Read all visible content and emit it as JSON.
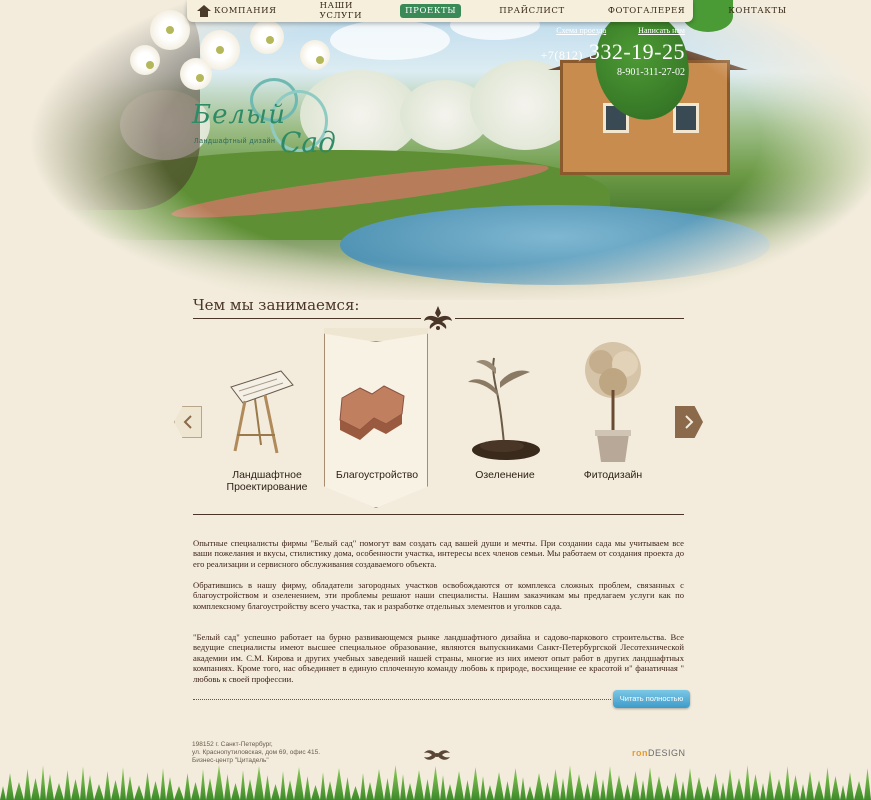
{
  "nav": {
    "home_icon": "home-icon",
    "items": [
      {
        "label": "КОМПАНИЯ",
        "active": false
      },
      {
        "label": "НАШИ УСЛУГИ",
        "active": false
      },
      {
        "label": "ПРОЕКТЫ",
        "active": true
      },
      {
        "label": "ПРАЙСЛИСТ",
        "active": false
      },
      {
        "label": "ФОТОГАЛЕРЕЯ",
        "active": false
      },
      {
        "label": "КОНТАКТЫ",
        "active": false
      }
    ]
  },
  "contacts": {
    "map_link": "Схема проезда",
    "write_link": "Написать нам",
    "phone_code": "+7(812)",
    "phone_number": "332-19-25",
    "mobile": "8-901-311-27-02"
  },
  "logo": {
    "title_part1": "Белый",
    "title_part2": "Сад",
    "tagline": "Ландшафтный дизайн"
  },
  "section": {
    "title": "Чем мы занимаемся:"
  },
  "services": [
    {
      "label_line1": "Ландшафтное",
      "label_line2": "Проектирование",
      "icon": "drafting-table-icon"
    },
    {
      "label_line1": "Благоустройство",
      "label_line2": "",
      "icon": "paving-stone-icon",
      "selected": true
    },
    {
      "label_line1": "Озеленение",
      "label_line2": "",
      "icon": "sprout-icon"
    },
    {
      "label_line1": "Фитодизайн",
      "label_line2": "",
      "icon": "potted-tree-icon"
    }
  ],
  "body": {
    "p1": "Опытные специалисты фирмы \"Белый сад\" помогут вам создать сад вашей души и мечты. При создании сада мы учитываем все ваши пожелания и вкусы, стилистику дома, особенности участка, интересы всех членов семьи. Мы работаем от создания проекта до его реализации и сервисного обслуживания создаваемого объекта.",
    "p2": "Обратившись в нашу фирму, обладатели загородных участков освобождаются от комплекса сложных проблем, связанных с благоустройством и озеленением, эти проблемы решают наши специалисты. Нашим заказчикам мы предлагаем услуги как по комплексному благоустройству всего участка, так и разработке отдельных элементов и уголков сада.",
    "p3": "\"Белый сад\" успешно работает на бурно развивающемся рынке ландшафтного дизайна и садово-паркового строительства. Все ведущие специалисты имеют высшее специальное образование, являются выпускниками Санкт-Петербургской Лесотехнической академии им. С.М. Кирова и других учебных заведений нашей страны, многие из них имеют опыт работ в других ландшафтных компаниях. Кроме того, нас объединяет в единую сплоченную команду любовь к природе, восхищение ее красотой и\" фанатичная \" любовь к своей профессии.",
    "read_more": "Читать полностью"
  },
  "footer": {
    "address_line1": "198152 г. Санкт-Петербург,",
    "address_line2": "ул. Краснопутиловская, дом 69, офис 415.",
    "address_line3": "Бизнес-центр \"Цитадель\"",
    "dev_prefix": "ron",
    "dev_suffix": "DESIGN"
  },
  "colors": {
    "background": "#f3ecdd",
    "nav_active": "#3a8a58",
    "logo_green": "#2f8a66",
    "button_blue": "#3d9bc9"
  }
}
